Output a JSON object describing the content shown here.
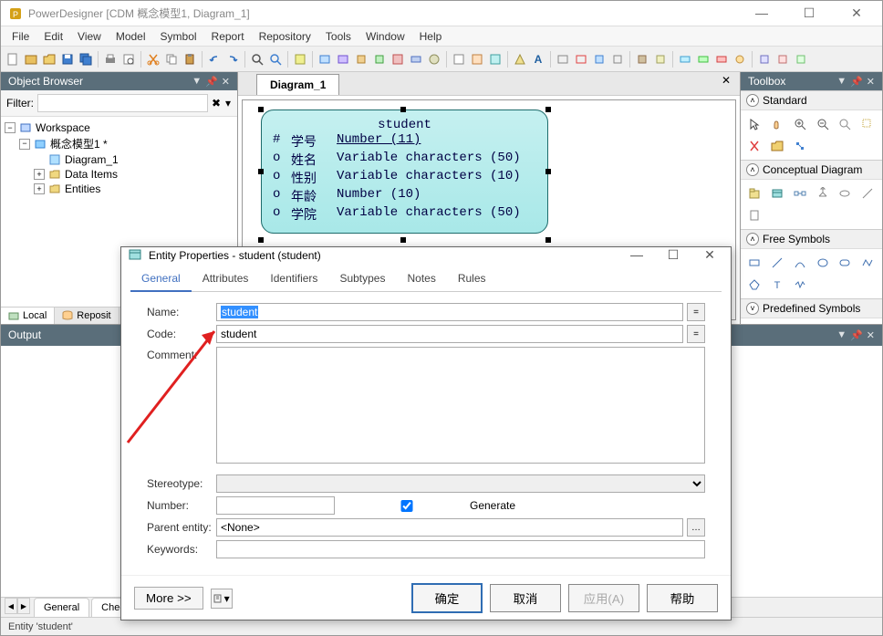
{
  "app": {
    "title": "PowerDesigner [CDM 概念模型1, Diagram_1]"
  },
  "menu": [
    "File",
    "Edit",
    "View",
    "Model",
    "Symbol",
    "Report",
    "Repository",
    "Tools",
    "Window",
    "Help"
  ],
  "object_browser": {
    "title": "Object Browser",
    "filter_label": "Filter:",
    "tree": {
      "root": "Workspace",
      "model": "概念模型1 *",
      "diagram": "Diagram_1",
      "data_items": "Data Items",
      "entities": "Entities"
    },
    "tabs": {
      "local": "Local",
      "repository": "Reposit"
    }
  },
  "diagram": {
    "tab": "Diagram_1",
    "entity": {
      "name": "student",
      "rows": [
        {
          "marker": "#",
          "name": "学号",
          "type": "Number (11)",
          "pk": true
        },
        {
          "marker": "o",
          "name": "姓名",
          "type": "Variable characters (50)",
          "pk": false
        },
        {
          "marker": "o",
          "name": "性别",
          "type": "Variable characters (10)",
          "pk": false
        },
        {
          "marker": "o",
          "name": "年龄",
          "type": "Number (10)",
          "pk": false
        },
        {
          "marker": "o",
          "name": "学院",
          "type": "Variable characters (50)",
          "pk": false
        }
      ]
    }
  },
  "toolbox": {
    "title": "Toolbox",
    "sections": {
      "standard": "Standard",
      "conceptual": "Conceptual Diagram",
      "free": "Free Symbols",
      "predefined": "Predefined Symbols"
    }
  },
  "output": {
    "title": "Output"
  },
  "dialog": {
    "title": "Entity Properties - student (student)",
    "tabs": [
      "General",
      "Attributes",
      "Identifiers",
      "Subtypes",
      "Notes",
      "Rules"
    ],
    "active_tab": "General",
    "fields": {
      "name_label": "Name:",
      "name_value": "student",
      "code_label": "Code:",
      "code_value": "student",
      "comment_label": "Comment:",
      "comment_value": "",
      "stereotype_label": "Stereotype:",
      "stereotype_value": "",
      "number_label": "Number:",
      "number_value": "",
      "generate_label": "Generate",
      "generate_checked": true,
      "parent_label": "Parent entity:",
      "parent_value": "<None>",
      "keywords_label": "Keywords:",
      "keywords_value": ""
    },
    "buttons": {
      "more": "More >>",
      "ok": "确定",
      "cancel": "取消",
      "apply": "应用(A)",
      "help": "帮助"
    }
  },
  "bottom_tabs": {
    "general": "General",
    "check": "Chec"
  },
  "status": "Entity 'student'"
}
